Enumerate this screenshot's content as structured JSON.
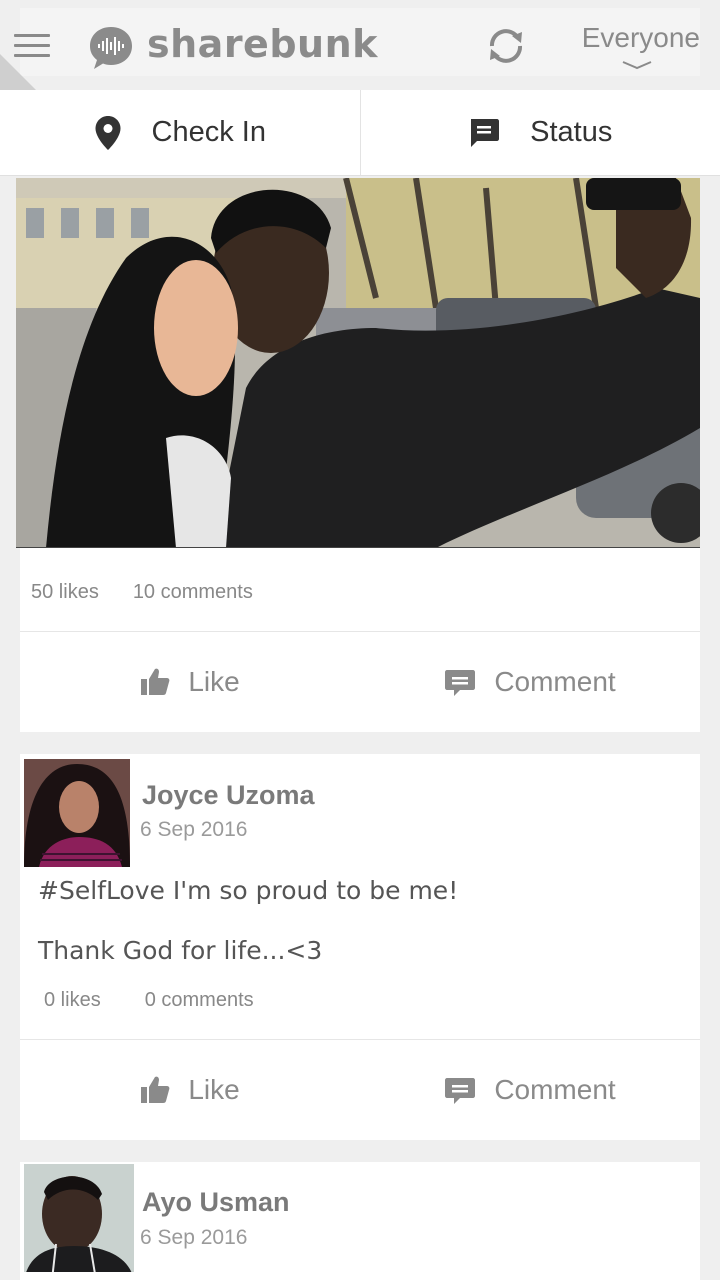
{
  "header": {
    "app_name": "sharebunk",
    "audience": "Everyone"
  },
  "actions": {
    "check_in": "Check In",
    "status": "Status"
  },
  "posts": [
    {
      "likes": "50 likes",
      "comments": "10 comments",
      "like_label": "Like",
      "comment_label": "Comment"
    },
    {
      "author": "Joyce Uzoma",
      "date": "6 Sep 2016",
      "line1": "#SelfLove I'm so proud to be me!",
      "line2": "Thank God for life...<3",
      "likes": "0 likes",
      "comments": "0 comments",
      "like_label": "Like",
      "comment_label": "Comment"
    },
    {
      "author": "Ayo Usman",
      "date": "6 Sep 2016"
    }
  ]
}
